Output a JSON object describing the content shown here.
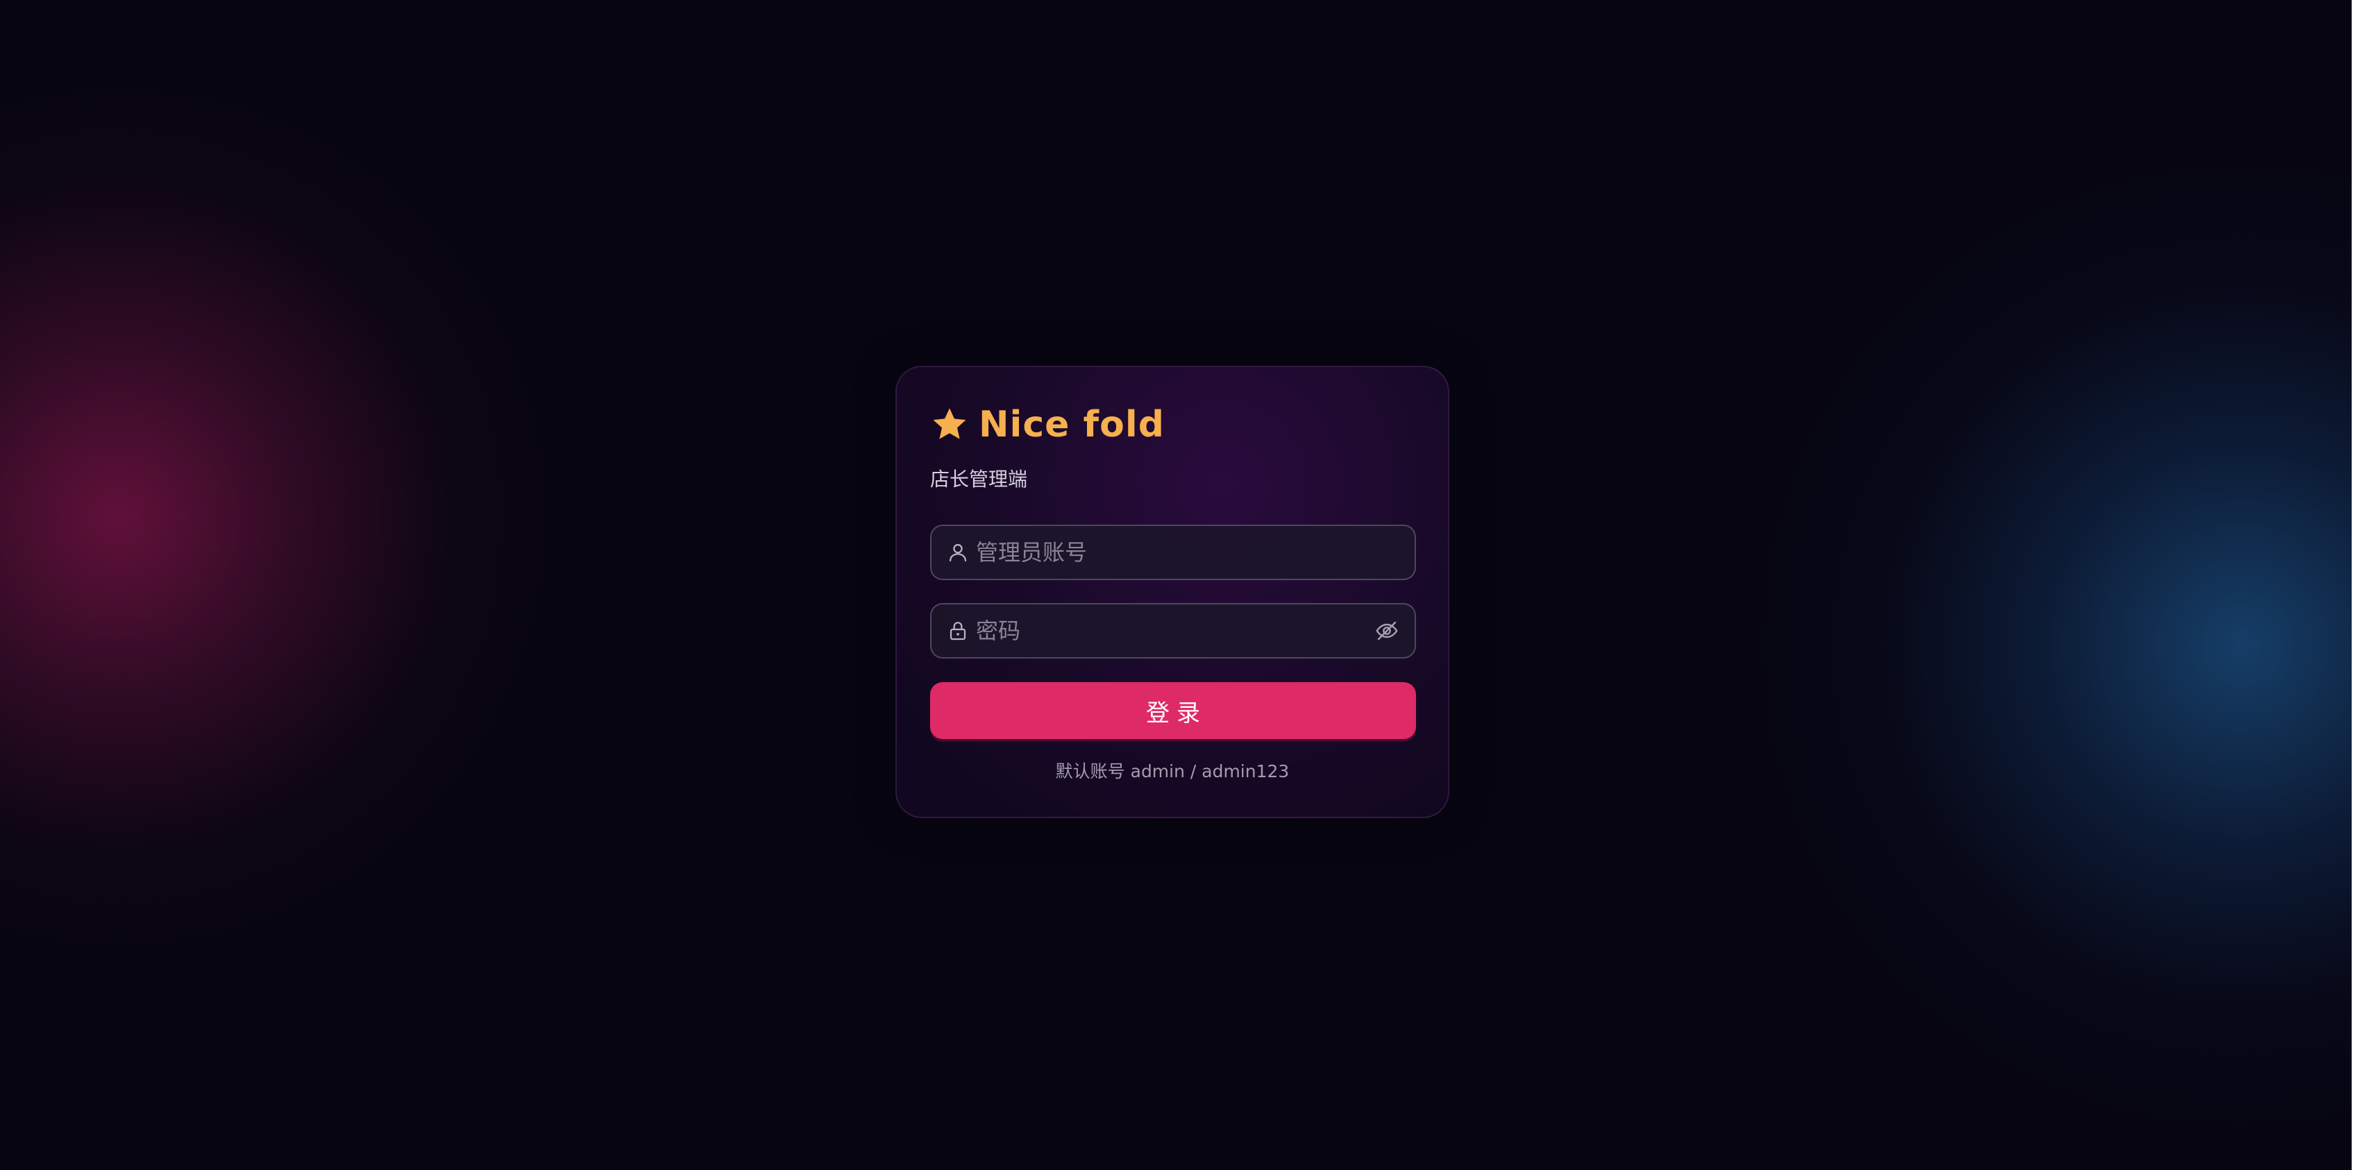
{
  "brand": {
    "icon": "star-icon",
    "title": "Nice fold",
    "subtitle": "店长管理端"
  },
  "form": {
    "username": {
      "icon": "user-icon",
      "placeholder": "管理员账号",
      "value": ""
    },
    "password": {
      "icon": "lock-icon",
      "placeholder": "密码",
      "value": "",
      "toggle_icon": "eye-off-icon"
    },
    "submit_label": "登录"
  },
  "hint": "默认账号 admin / admin123",
  "colors": {
    "accent": "#f6b04d",
    "primary_button": "#df2a68",
    "background": "#070512"
  }
}
